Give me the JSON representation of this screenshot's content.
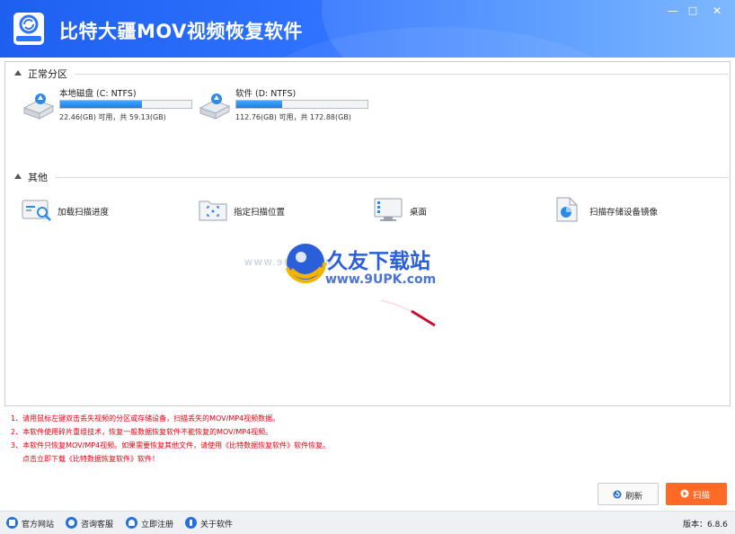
{
  "app": {
    "title": "比特大疆MOV视频恢复软件",
    "window_controls": [
      "—",
      "□",
      "✕"
    ]
  },
  "sections": {
    "normal": {
      "title": "正常分区",
      "drives": [
        {
          "name": "本地磁盘 (C: NTFS)",
          "capacity": "22.46(GB) 可用，共 59.13(GB)",
          "used_fraction": 0.62
        },
        {
          "name": "软件 (D: NTFS)",
          "capacity": "112.76(GB) 可用，共 172.88(GB)",
          "used_fraction": 0.35
        }
      ]
    },
    "other": {
      "title": "其他",
      "items": [
        {
          "label": "加载扫描进度",
          "icon": "load-progress-icon"
        },
        {
          "label": "指定扫描位置",
          "icon": "folder-target-icon"
        },
        {
          "label": "桌面",
          "icon": "desktop-icon"
        },
        {
          "label": "扫描存储设备镜像",
          "icon": "disk-image-icon"
        }
      ]
    }
  },
  "watermark": {
    "cn": "久友下载站",
    "url": "www.9UPK.com",
    "www": "WWW.9UPK.COM"
  },
  "tips": [
    "1、请用鼠标左键双击丢失视频的分区或存储设备，扫描丢失的MOV/MP4视频数据。",
    "2、本软件使用碎片重组技术，恢复一般数据恢复软件不能恢复的MOV/MP4视频。",
    "3、本软件只恢复MOV/MP4视频。如果需要恢复其他文件，请使用《比特数据恢复软件》软件恢复。",
    "点击立即下载《比特数据恢复软件》软件！"
  ],
  "buttons": {
    "refresh": "刷新",
    "scan": "扫描"
  },
  "statusbar": {
    "links": [
      {
        "label": "官方网站",
        "icon": "home-icon"
      },
      {
        "label": "咨询客服",
        "icon": "chat-icon"
      },
      {
        "label": "立即注册",
        "icon": "user-add-icon"
      },
      {
        "label": "关于软件",
        "icon": "download-icon"
      }
    ],
    "version": "版本：6.8.6"
  },
  "colors": {
    "titlebar": "#2f73ff",
    "accent_orange": "#ff6a26",
    "tip_red": "#e60012",
    "bar_blue": "#1a7fe0"
  }
}
